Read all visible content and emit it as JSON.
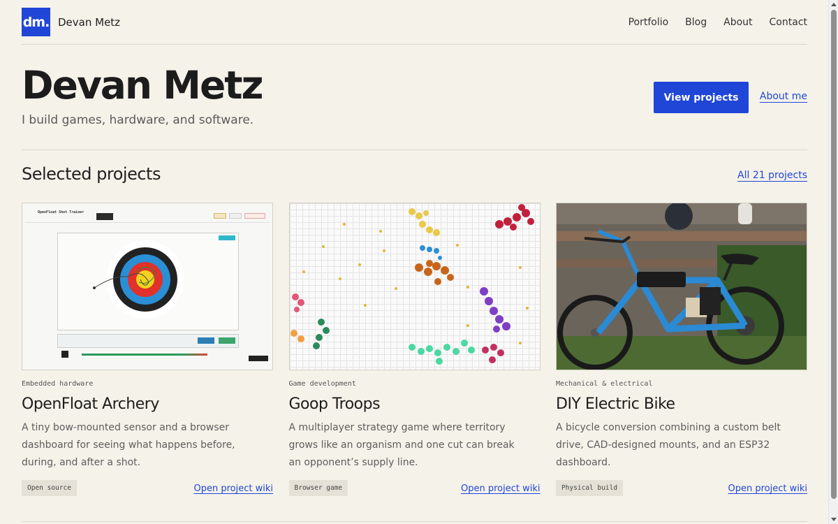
{
  "header": {
    "logo": "dm.",
    "brand_name": "Devan Metz",
    "nav": [
      "Portfolio",
      "Blog",
      "About",
      "Contact"
    ]
  },
  "hero": {
    "title": "Devan Metz",
    "subtitle": "I build games, hardware, and software.",
    "primary_button": "View projects",
    "secondary_link": "About me"
  },
  "projects_section": {
    "title": "Selected projects",
    "all_link": "All 21 projects",
    "cards": [
      {
        "category": "Embedded hardware",
        "title": "OpenFloat Archery",
        "description": "A tiny bow-mounted sensor and a browser dashboard for seeing what happens before, during, and after a shot.",
        "tag": "Open source",
        "link": "Open project wiki",
        "thumb_title": "OpenFloat Shot Trainer"
      },
      {
        "category": "Game development",
        "title": "Goop Troops",
        "description": "A multiplayer strategy game where territory grows like an organism and one cut can break an opponent’s supply line.",
        "tag": "Browser game",
        "link": "Open project wiki"
      },
      {
        "category": "Mechanical & electrical",
        "title": "DIY Electric Bike",
        "description": "A bicycle conversion combining a custom belt drive, CAD-designed mounts, and an ESP32 dashboard.",
        "tag": "Physical build",
        "link": "Open project wiki"
      }
    ]
  },
  "colors": {
    "accent": "#2046d8",
    "background": "#f5f2ea",
    "tag_bg": "#e5e1d6"
  }
}
